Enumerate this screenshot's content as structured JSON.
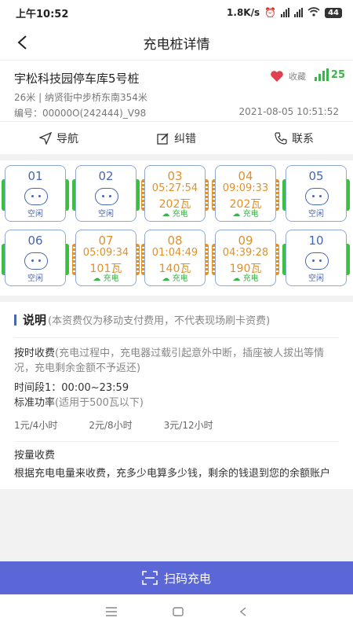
{
  "status": {
    "time": "上午10:52",
    "speed": "1.8K/s",
    "battery": "44"
  },
  "nav": {
    "title": "充电桩详情"
  },
  "station": {
    "name": "宇松科技园停车库5号桩",
    "distance": "26米 | 纳贤街中步桥东南354米",
    "code": "编号：00000O(242444)_V98",
    "datetime": "2021-08-05 10:51:52",
    "fav_label": "收藏",
    "signal": "25"
  },
  "actions": [
    {
      "label": "导航",
      "icon": "navigation-arrow-icon"
    },
    {
      "label": "纠错",
      "icon": "edit-icon"
    },
    {
      "label": "联系",
      "icon": "phone-icon"
    }
  ],
  "piles": [
    {
      "num": "01",
      "status": "idle",
      "state": "空闲"
    },
    {
      "num": "02",
      "status": "idle",
      "state": "空闲"
    },
    {
      "num": "03",
      "status": "busy",
      "state": "充电",
      "timer": "05:27:54",
      "power": "202瓦"
    },
    {
      "num": "04",
      "status": "busy",
      "state": "充电",
      "timer": "09:09:33",
      "power": "202瓦"
    },
    {
      "num": "05",
      "status": "idle",
      "state": "空闲"
    },
    {
      "num": "06",
      "status": "idle",
      "state": "空闲"
    },
    {
      "num": "07",
      "status": "busy",
      "state": "充电",
      "timer": "05:09:34",
      "power": "101瓦"
    },
    {
      "num": "08",
      "status": "busy",
      "state": "充电",
      "timer": "01:04:49",
      "power": "140瓦"
    },
    {
      "num": "09",
      "status": "busy",
      "state": "充电",
      "timer": "04:39:28",
      "power": "190瓦"
    },
    {
      "num": "10",
      "status": "idle",
      "state": "空闲"
    }
  ],
  "notes": {
    "title": "说明",
    "subtitle": "(本资费仅为移动支付费用，不代表现场刷卡资费)",
    "time_fee_title": "按时收费",
    "time_fee_desc": "(充电过程中，充电器过载引起意外中断，插座被人拔出等情况，充电剩余金额不予返还)",
    "period": "时间段1：00:00~23:59",
    "std_power": "标准功率",
    "std_power_note": "(适用于500瓦以下)",
    "rates": [
      "1元/4小时",
      "2元/8小时",
      "3元/12小时"
    ],
    "energy_fee_title": "按量收费",
    "energy_fee_desc": "根据充电电量来收费，充多少电算多少钱，剩余的钱退到您的余额账户"
  },
  "scan": {
    "label": "扫码充电"
  }
}
